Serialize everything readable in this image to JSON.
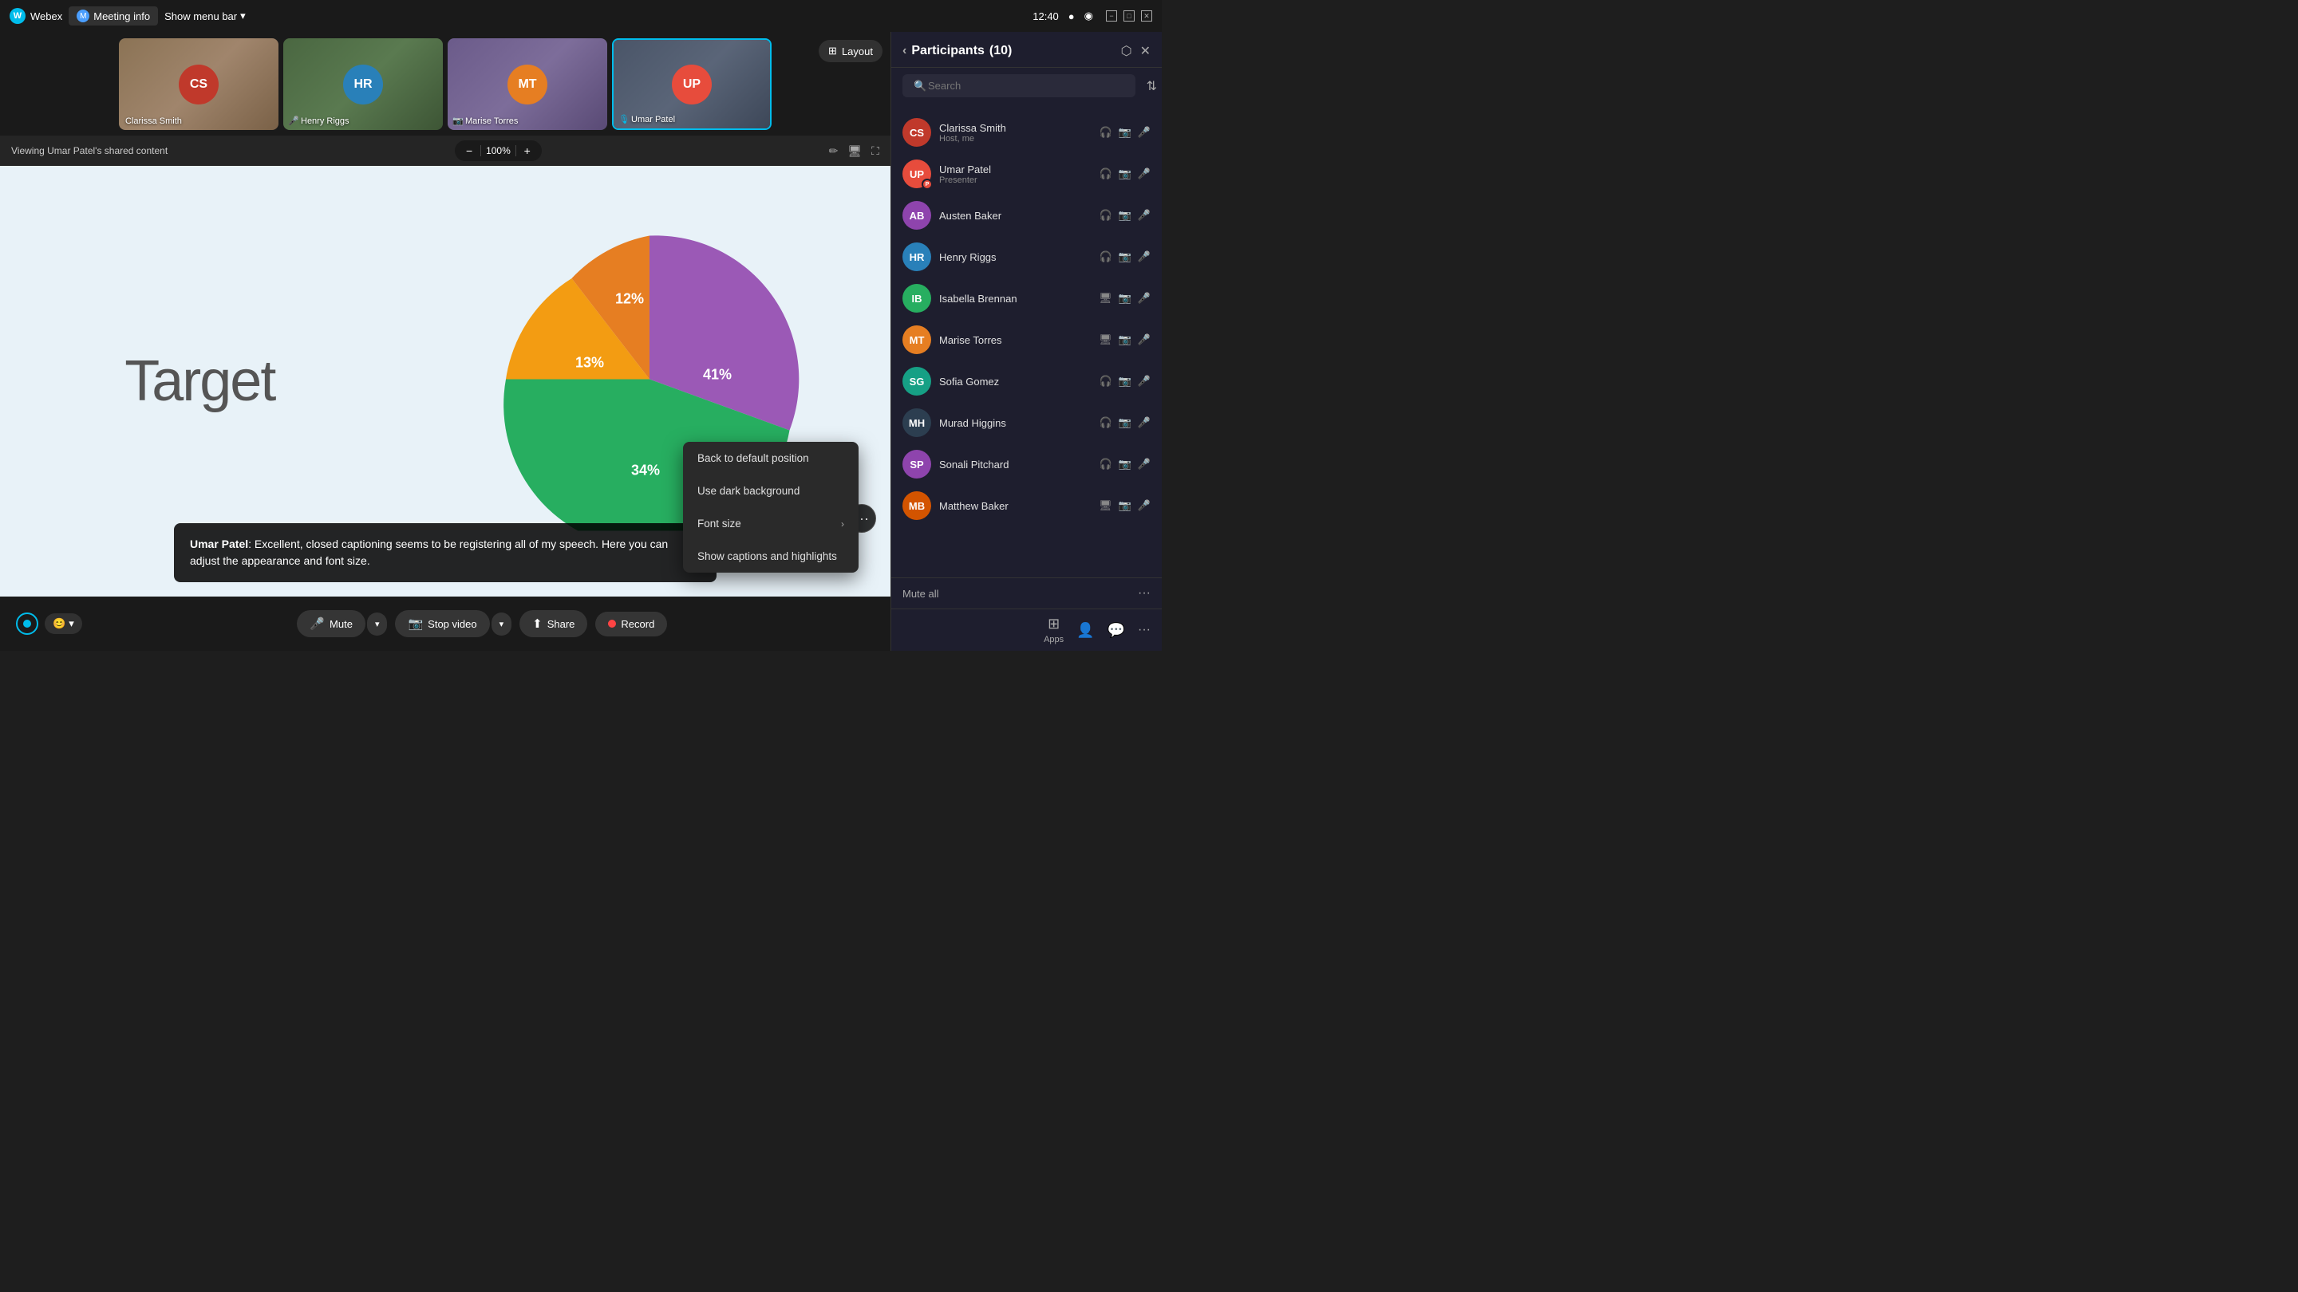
{
  "titlebar": {
    "app_name": "Webex",
    "meeting_info": "Meeting info",
    "show_menu": "Show menu bar",
    "time": "12:40"
  },
  "thumbnails": [
    {
      "id": "clarissa",
      "name": "Clarissa Smith",
      "css_class": "thumb-clarissa"
    },
    {
      "id": "henry",
      "name": "Henry Riggs",
      "css_class": "thumb-henry"
    },
    {
      "id": "marise",
      "name": "Marise Torres",
      "css_class": "thumb-marise"
    },
    {
      "id": "umar",
      "name": "Umar Patel",
      "css_class": "thumb-umar",
      "active": true
    }
  ],
  "viewing_bar": {
    "text": "Viewing Umar Patel's shared content",
    "zoom": "100%",
    "minus": "−",
    "plus": "+"
  },
  "slide": {
    "target_label": "Target",
    "pie_segments": [
      {
        "label": "41%",
        "color": "#9b59b6",
        "startAngle": 0,
        "endAngle": 147.6
      },
      {
        "label": "34%",
        "color": "#2ecc71",
        "startAngle": 147.6,
        "endAngle": 270
      },
      {
        "label": "13%",
        "color": "#f39c12",
        "startAngle": 270,
        "endAngle": 316.8
      },
      {
        "label": "12%",
        "color": "#e67e22",
        "startAngle": 316.8,
        "endAngle": 360
      }
    ]
  },
  "caption": {
    "speaker": "Umar Patel",
    "colon": ":",
    "text": " Excellent, closed captioning seems to be registering all of my speech. Here you can adjust the appearance and font size."
  },
  "context_menu": {
    "items": [
      {
        "id": "back-default",
        "label": "Back to default position",
        "has_arrow": false
      },
      {
        "id": "dark-bg",
        "label": "Use dark background",
        "has_arrow": false
      },
      {
        "id": "font-size",
        "label": "Font size",
        "has_arrow": true
      },
      {
        "id": "show-captions",
        "label": "Show captions and highlights",
        "has_arrow": false
      }
    ]
  },
  "toolbar": {
    "mute_label": "Mute",
    "stop_video_label": "Stop video",
    "share_label": "Share",
    "record_label": "Record"
  },
  "participants_panel": {
    "title": "Participants",
    "count": "(10)",
    "search_placeholder": "Search",
    "mute_all": "Mute all",
    "participants": [
      {
        "id": "clarissa",
        "name": "Clarissa Smith",
        "role": "Host, me",
        "avatar_color": "#c0392b",
        "initials": "CS"
      },
      {
        "id": "umar",
        "name": "Umar Patel",
        "role": "Presenter",
        "avatar_color": "#e74c3c",
        "initials": "UP"
      },
      {
        "id": "austen",
        "name": "Austen Baker",
        "role": "",
        "avatar_color": "#8e44ad",
        "initials": "AB"
      },
      {
        "id": "henry",
        "name": "Henry Riggs",
        "role": "",
        "avatar_color": "#2980b9",
        "initials": "HR"
      },
      {
        "id": "isabella",
        "name": "Isabella Brennan",
        "role": "",
        "avatar_color": "#27ae60",
        "initials": "IB"
      },
      {
        "id": "marise",
        "name": "Marise Torres",
        "role": "",
        "avatar_color": "#e67e22",
        "initials": "MT"
      },
      {
        "id": "sofia",
        "name": "Sofia Gomez",
        "role": "",
        "avatar_color": "#16a085",
        "initials": "SG"
      },
      {
        "id": "murad",
        "name": "Murad Higgins",
        "role": "",
        "avatar_color": "#2c3e50",
        "initials": "MH"
      },
      {
        "id": "sonali",
        "name": "Sonali Pitchard",
        "role": "",
        "avatar_color": "#8e44ad",
        "initials": "SP"
      },
      {
        "id": "matthew",
        "name": "Matthew Baker",
        "role": "",
        "avatar_color": "#d35400",
        "initials": "MB"
      }
    ]
  },
  "bottom_panel": {
    "apps_label": "Apps",
    "people_label": "",
    "chat_label": ""
  }
}
